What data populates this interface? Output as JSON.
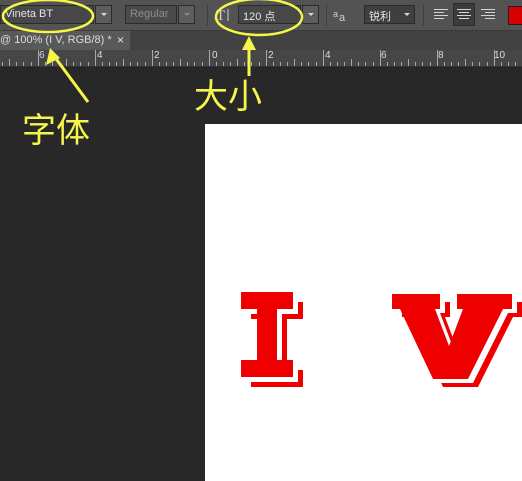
{
  "options_bar": {
    "font_family": "Vineta BT",
    "font_style": "Regular",
    "font_size": "120 点",
    "size_icon": "font-size-icon",
    "aa_icon": "anti-alias-icon",
    "anti_alias": "锐利",
    "align_buttons": [
      "align-left",
      "align-center",
      "align-right"
    ],
    "active_align": "align-center",
    "text_color": "#d90000"
  },
  "tab": {
    "title": "@ 100% (I V, RGB/8) *",
    "close": "×"
  },
  "ruler": {
    "labels": [
      "6",
      "4",
      "2",
      "0",
      "2",
      "4",
      "6",
      "8",
      "10"
    ]
  },
  "canvas": {
    "text": "I V",
    "letter_color": "#ee0000",
    "shadow_color": "#ffffff"
  },
  "annotations": {
    "font_label": "字体",
    "size_label": "大小",
    "color": "#f6f64a"
  }
}
